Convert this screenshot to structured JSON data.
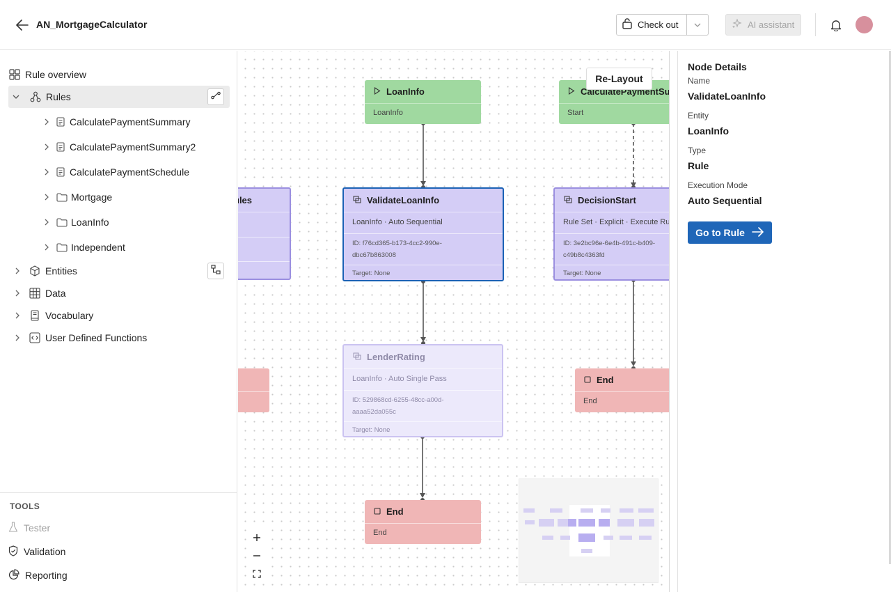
{
  "header": {
    "title": "AN_MortgageCalculator",
    "checkout_label": "Check out",
    "ai_label": "AI assistant"
  },
  "sidebar": {
    "overview": "Rule overview",
    "rules": "Rules",
    "rule_items": [
      {
        "label": "CalculatePaymentSummary",
        "icon": "rule-icon"
      },
      {
        "label": "CalculatePaymentSummary2",
        "icon": "rule-icon"
      },
      {
        "label": "CalculatePaymentSchedule",
        "icon": "rule-icon"
      },
      {
        "label": "Mortgage",
        "icon": "folder-icon"
      },
      {
        "label": "LoanInfo",
        "icon": "folder-icon"
      },
      {
        "label": "Independent",
        "icon": "folder-icon"
      }
    ],
    "entities": "Entities",
    "data": "Data",
    "vocabulary": "Vocabulary",
    "udf": "User Defined Functions",
    "tools_label": "TOOLS",
    "tools": [
      "Tester",
      "Validation",
      "Reporting"
    ]
  },
  "canvas": {
    "relayout": "Re-Layout",
    "partial_node_title": "ules",
    "nodes": {
      "loaninfo": {
        "title": "LoanInfo",
        "sub": "LoanInfo"
      },
      "calcpay": {
        "title": "CalculatePaymentSu",
        "sub": "Start"
      },
      "validate": {
        "title": "ValidateLoanInfo",
        "sub": "LoanInfo · Auto Sequential",
        "id1": "ID: f76cd365-b173-4cc2-990e-",
        "id2": "dbc67b863008",
        "target": "Target: None"
      },
      "decision": {
        "title": "DecisionStart",
        "sub": "Rule Set · Explicit · Execute Ru",
        "id1": "ID: 3e2bc96e-6e4b-491c-b409-",
        "id2": "c49b8c4363fd",
        "target": "Target: None"
      },
      "lender": {
        "title": "LenderRating",
        "sub": "LoanInfo · Auto Single Pass",
        "id1": "ID: 529868cd-6255-48cc-a00d-",
        "id2": "aaaa52da055c",
        "target": "Target: None"
      },
      "end_right": {
        "title": "End",
        "sub": "End"
      },
      "end_bottom": {
        "title": "End",
        "sub": "End"
      }
    }
  },
  "details": {
    "header": "Node Details",
    "name_label": "Name",
    "name_value": "ValidateLoanInfo",
    "entity_label": "Entity",
    "entity_value": "LoanInfo",
    "type_label": "Type",
    "type_value": "Rule",
    "mode_label": "Execution Mode",
    "mode_value": "Auto Sequential",
    "go_label": "Go to Rule"
  },
  "colors": {
    "accent": "#1f66b8",
    "start_node": "#a0d9a0",
    "rule_node": "#d4cdf6",
    "end_node": "#f0b6b6"
  }
}
